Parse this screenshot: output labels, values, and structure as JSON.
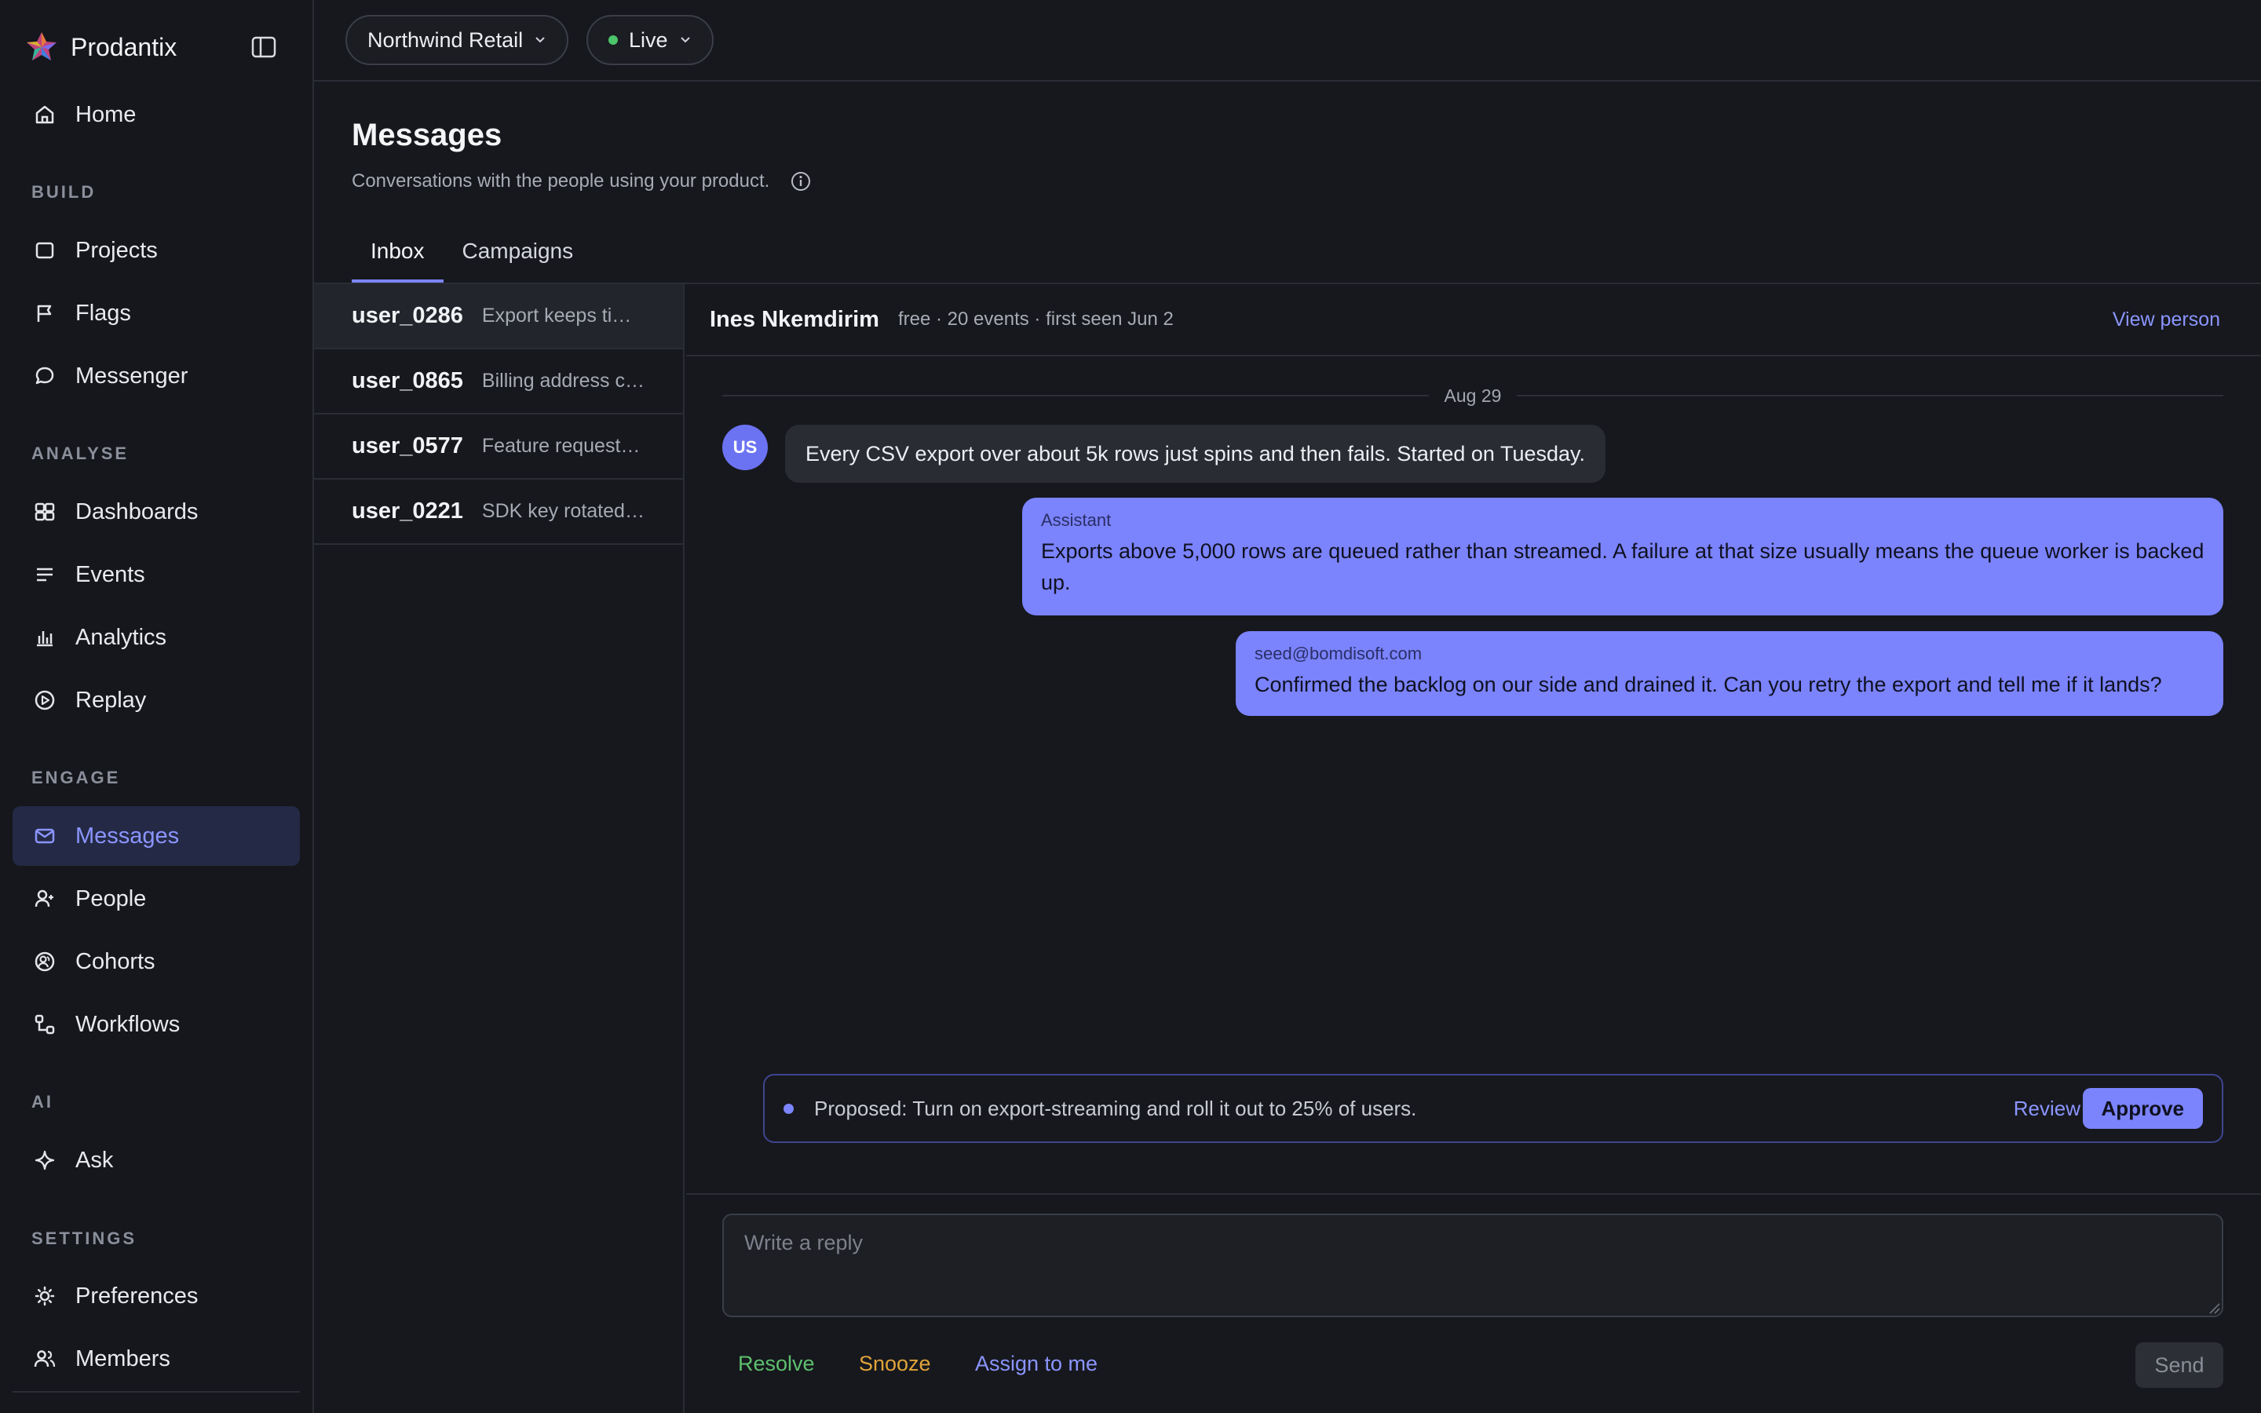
{
  "app": {
    "name": "Prodantix"
  },
  "sidebar": {
    "home": "Home",
    "sections": {
      "build": "BUILD",
      "analyse": "ANALYSE",
      "engage": "ENGAGE",
      "ai": "AI",
      "settings": "SETTINGS"
    },
    "items": {
      "projects": "Projects",
      "flags": "Flags",
      "messenger": "Messenger",
      "dashboards": "Dashboards",
      "events": "Events",
      "analytics": "Analytics",
      "replay": "Replay",
      "messages": "Messages",
      "people": "People",
      "cohorts": "Cohorts",
      "workflows": "Workflows",
      "ask": "Ask",
      "preferences": "Preferences",
      "members": "Members"
    },
    "active_item": "messages"
  },
  "topbar": {
    "workspace": "Northwind Retail",
    "environment": "Live",
    "environment_status_color": "#4cc46a"
  },
  "page": {
    "title": "Messages",
    "subtitle": "Conversations with the people using your product.",
    "tabs": [
      "Inbox",
      "Campaigns"
    ],
    "active_tab": "Inbox"
  },
  "conversations": [
    {
      "user": "user_0286",
      "preview": "Export keeps timing out",
      "selected": true
    },
    {
      "user": "user_0865",
      "preview": "Billing address change",
      "selected": false
    },
    {
      "user": "user_0577",
      "preview": "Feature request: dark mode",
      "selected": false
    },
    {
      "user": "user_0221",
      "preview": "SDK key rotated and now",
      "selected": false
    }
  ],
  "thread": {
    "person_name": "Ines Nkemdirim",
    "person_meta": "free · 20 events · first seen Jun 2",
    "view_person": "View person",
    "date": "Aug 29",
    "avatar_initials": "US",
    "messages": [
      {
        "from": "user",
        "text": "Every CSV export over about 5k rows just spins and then fails. Started on Tuesday."
      },
      {
        "from": "agent",
        "author": "Assistant",
        "text": "Exports above 5,000 rows are queued rather than streamed. A failure at that size usually means the queue worker is backed up."
      },
      {
        "from": "agent",
        "author": "seed@bomdisoft.com",
        "text": "Confirmed the backlog on our side and drained it. Can you retry the export and tell me if it lands?"
      }
    ],
    "proposal": {
      "text": "Proposed: Turn on export-streaming and roll it out to 25% of users.",
      "review": "Review",
      "approve": "Approve"
    }
  },
  "composer": {
    "placeholder": "Write a reply",
    "actions": {
      "resolve": "Resolve",
      "snooze": "Snooze",
      "assign": "Assign to me"
    },
    "send": "Send"
  },
  "colors": {
    "accent": "#7b83fd",
    "resolve": "#5fbf6e",
    "snooze": "#e0a33a",
    "assign": "#8b95ff"
  }
}
